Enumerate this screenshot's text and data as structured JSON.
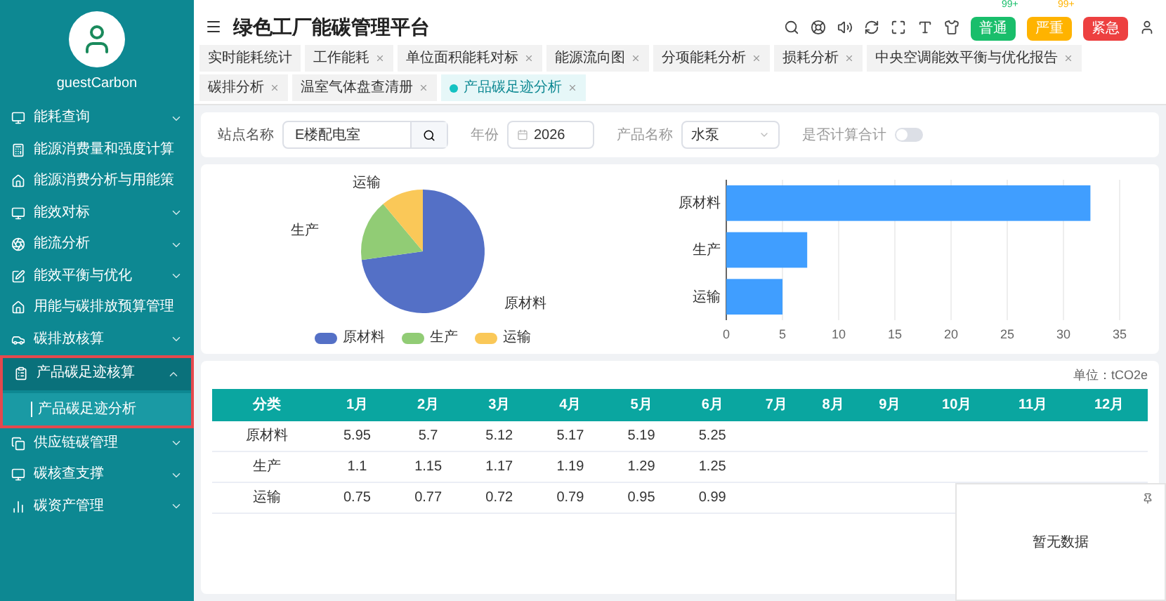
{
  "sidebar": {
    "user": "guestCarbon",
    "items": [
      {
        "label": "能耗查询",
        "has_submenu": true,
        "expanded": false,
        "outlined": false
      },
      {
        "label": "能源消费量和强度计算",
        "has_submenu": false,
        "expanded": false,
        "outlined": false
      },
      {
        "label": "能源消费分析与用能策",
        "has_submenu": false,
        "expanded": false,
        "outlined": false
      },
      {
        "label": "能效对标",
        "has_submenu": true,
        "expanded": false,
        "outlined": false
      },
      {
        "label": "能流分析",
        "has_submenu": true,
        "expanded": false,
        "outlined": false
      },
      {
        "label": "能效平衡与优化",
        "has_submenu": true,
        "expanded": false,
        "outlined": false
      },
      {
        "label": "用能与碳排放预算管理",
        "has_submenu": false,
        "expanded": false,
        "outlined": false
      },
      {
        "label": "碳排放核算",
        "has_submenu": true,
        "expanded": false,
        "outlined": false
      },
      {
        "label": "产品碳足迹核算",
        "has_submenu": true,
        "expanded": true,
        "outlined": true,
        "children": [
          {
            "label": "产品碳足迹分析",
            "selected": true
          }
        ]
      },
      {
        "label": "供应链碳管理",
        "has_submenu": true,
        "expanded": false,
        "outlined": false
      },
      {
        "label": "碳核查支撑",
        "has_submenu": true,
        "expanded": false,
        "outlined": false
      },
      {
        "label": "碳资产管理",
        "has_submenu": true,
        "expanded": false,
        "outlined": false
      }
    ]
  },
  "header": {
    "title": "绿色工厂能碳管理平台",
    "alerts": [
      {
        "label": "普通",
        "count": "99+",
        "color": "#19be6b"
      },
      {
        "label": "严重",
        "count": "99+",
        "color": "#ffb300"
      },
      {
        "label": "紧急",
        "color": "#ed4040"
      }
    ]
  },
  "tabs": [
    {
      "label": "实时能耗统计",
      "selected": false,
      "closable": false
    },
    {
      "label": "工作能耗",
      "selected": false,
      "closable": true
    },
    {
      "label": "单位面积能耗对标",
      "selected": false,
      "closable": true
    },
    {
      "label": "能源流向图",
      "selected": false,
      "closable": true
    },
    {
      "label": "分项能耗分析",
      "selected": false,
      "closable": true
    },
    {
      "label": "损耗分析",
      "selected": false,
      "closable": true
    },
    {
      "label": "中央空调能效平衡与优化报告",
      "selected": false,
      "closable": true
    },
    {
      "label": "碳排分析",
      "selected": false,
      "closable": true
    },
    {
      "label": "温室气体盘查清册",
      "selected": false,
      "closable": true
    },
    {
      "label": "产品碳足迹分析",
      "selected": true,
      "closable": true
    }
  ],
  "filters": {
    "station": {
      "label": "站点名称",
      "value": "E楼配电室"
    },
    "year": {
      "label": "年份",
      "value": "2026"
    },
    "product": {
      "label": "产品名称",
      "value": "水泵"
    },
    "total": {
      "label": "是否计算合计",
      "on": false
    }
  },
  "charts": {
    "pie": {
      "chart_data": {
        "type": "pie",
        "categories": [
          "原材料",
          "生产",
          "运输"
        ],
        "values": [
          72.8,
          16.1,
          11.1
        ],
        "legend": "bottom"
      }
    },
    "bar": {
      "chart_data": {
        "type": "bar",
        "orientation": "horizontal",
        "categories": [
          "原材料",
          "生产",
          "运输"
        ],
        "values": [
          32.4,
          7.2,
          5.0
        ],
        "xlim": [
          0,
          35
        ],
        "xticks": [
          0,
          5,
          10,
          15,
          20,
          25,
          30,
          35
        ],
        "grid": true
      }
    }
  },
  "table": {
    "unit": "单位：tCO2e",
    "columns": [
      "分类",
      "1月",
      "2月",
      "3月",
      "4月",
      "5月",
      "6月",
      "7月",
      "8月",
      "9月",
      "10月",
      "11月",
      "12月"
    ],
    "rows": [
      [
        "原材料",
        "5.95",
        "5.7",
        "5.12",
        "5.17",
        "5.19",
        "5.25"
      ],
      [
        "生产",
        "1.1",
        "1.15",
        "1.17",
        "1.19",
        "1.29",
        "1.25"
      ],
      [
        "运输",
        "0.75",
        "0.77",
        "0.72",
        "0.79",
        "0.95",
        "0.99"
      ]
    ]
  },
  "popup": {
    "text": "暂无数据"
  }
}
